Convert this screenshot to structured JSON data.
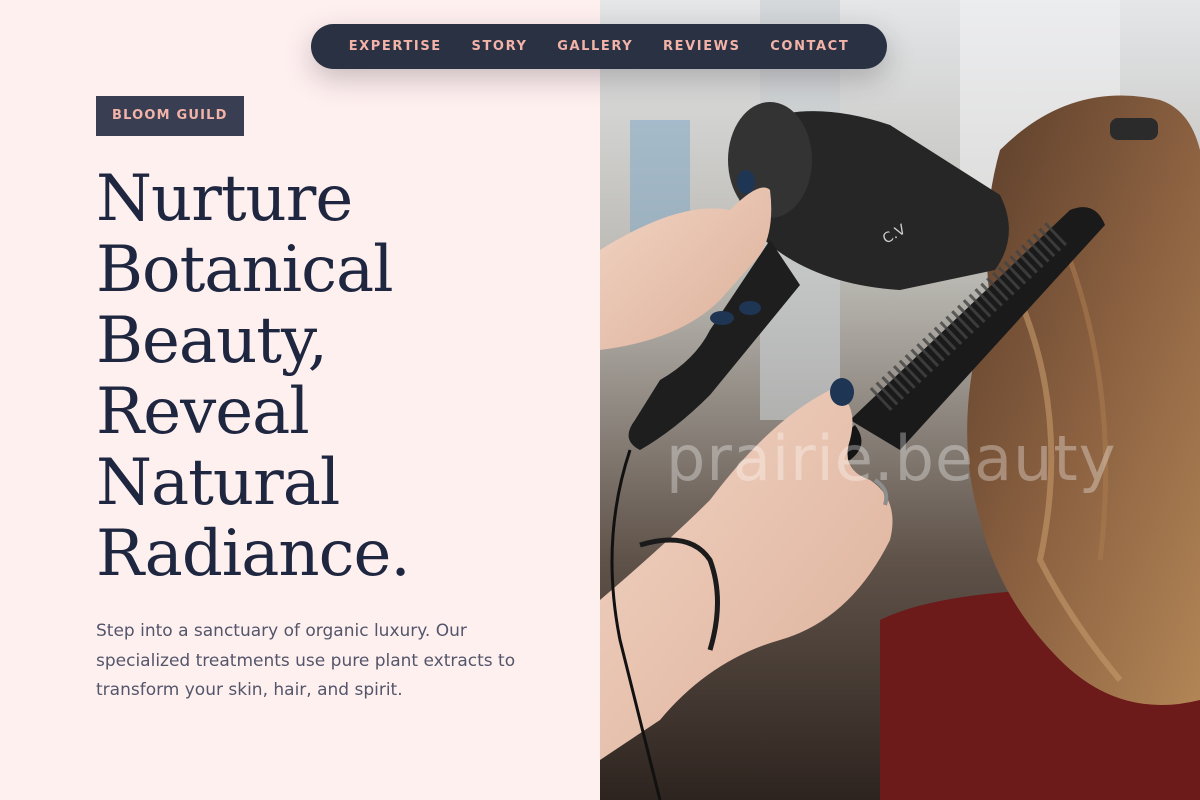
{
  "nav": {
    "items": [
      "EXPERTISE",
      "STORY",
      "GALLERY",
      "REVIEWS",
      "CONTACT"
    ]
  },
  "hero": {
    "badge": "BLOOM GUILD",
    "headline_lines": [
      "Nurture",
      "Botanical",
      "Beauty,",
      "Reveal",
      "Natural",
      "Radiance."
    ],
    "subtext": "Step into a sanctuary of organic luxury. Our specialized treatments use pure plant extracts to transform your skin, hair, and spirit."
  },
  "photo": {
    "watermark": "prairie.beauty"
  },
  "colors": {
    "background": "#fff0f0",
    "nav_background": "#2a3142",
    "accent": "#f2b3a8",
    "headline": "#1f2740",
    "body_text": "#53566a"
  }
}
